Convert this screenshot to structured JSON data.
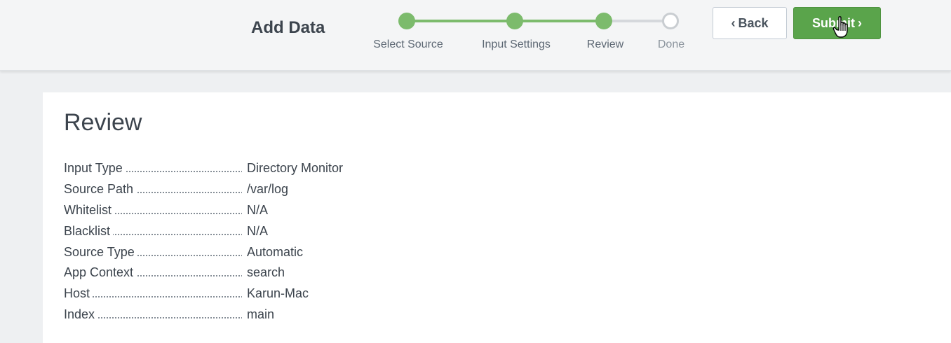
{
  "header": {
    "title": "Add Data",
    "steps": [
      {
        "label": "Select Source",
        "state": "complete"
      },
      {
        "label": "Input Settings",
        "state": "complete"
      },
      {
        "label": "Review",
        "state": "current"
      },
      {
        "label": "Done",
        "state": "pending"
      }
    ],
    "back_label": "Back",
    "submit_label": "Submit"
  },
  "review": {
    "title": "Review",
    "rows": [
      {
        "key": "Input Type",
        "value": "Directory Monitor"
      },
      {
        "key": "Source Path",
        "value": "/var/log"
      },
      {
        "key": "Whitelist",
        "value": "N/A"
      },
      {
        "key": "Blacklist",
        "value": "N/A"
      },
      {
        "key": "Source Type",
        "value": "Automatic"
      },
      {
        "key": "App Context",
        "value": "search"
      },
      {
        "key": "Host",
        "value": "Karun-Mac"
      },
      {
        "key": "Index",
        "value": "main"
      }
    ]
  },
  "colors": {
    "accent_green": "#5aa44b",
    "step_green": "#7cbb6c",
    "step_pending": "#c9cdd1"
  },
  "icons": {
    "back": "chevron-left-icon",
    "submit": "chevron-right-icon",
    "cursor": "hand-pointer-icon"
  }
}
